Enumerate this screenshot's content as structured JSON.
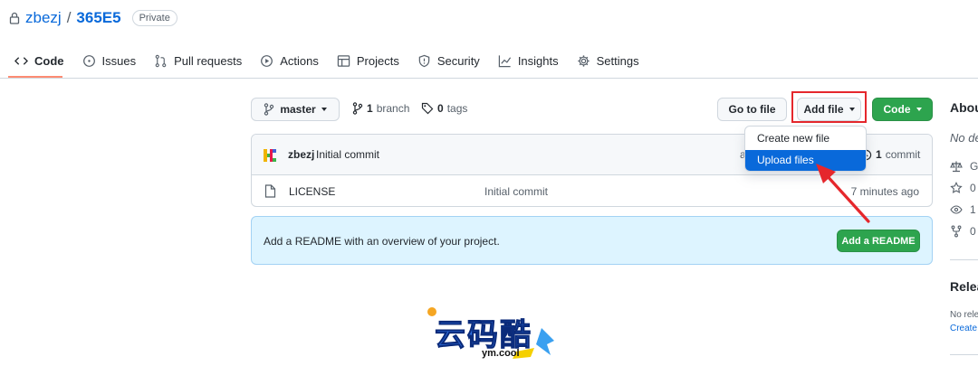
{
  "repo": {
    "owner": "zbezj",
    "separator": "/",
    "name": "365E5",
    "visibility": "Private"
  },
  "tabs": [
    {
      "label": "Code",
      "icon": "code-icon",
      "selected": true
    },
    {
      "label": "Issues",
      "icon": "issue-icon"
    },
    {
      "label": "Pull requests",
      "icon": "pull-request-icon"
    },
    {
      "label": "Actions",
      "icon": "play-icon"
    },
    {
      "label": "Projects",
      "icon": "table-icon"
    },
    {
      "label": "Security",
      "icon": "shield-icon"
    },
    {
      "label": "Insights",
      "icon": "graph-icon"
    },
    {
      "label": "Settings",
      "icon": "gear-icon"
    }
  ],
  "toolbar": {
    "branch": "master",
    "branch_count": "1",
    "branch_label": "branch",
    "tag_count": "0",
    "tag_label": "tags",
    "go_to_file": "Go to file",
    "add_file": "Add file",
    "code": "Code"
  },
  "dropdown": {
    "items": [
      {
        "label": "Create new file"
      },
      {
        "label": "Upload files",
        "active": true
      }
    ]
  },
  "latest_commit": {
    "author": "zbezj",
    "message": "Initial commit",
    "hash_fragment": "a",
    "commit_count": "1",
    "commit_label": "commit"
  },
  "files": [
    {
      "name": "LICENSE",
      "commit": "Initial commit",
      "age": "7 minutes ago"
    }
  ],
  "readme": {
    "text": "Add a README with an overview of your project.",
    "button": "Add a README"
  },
  "sidebar": {
    "about_title": "Abou",
    "description": "No de",
    "rows": [
      {
        "icon": "law-icon",
        "value": "G"
      },
      {
        "icon": "star-icon",
        "value": "0"
      },
      {
        "icon": "eye-icon",
        "value": "1"
      },
      {
        "icon": "fork-icon",
        "value": "0"
      }
    ],
    "releases_title": "Relea",
    "releases_note": "No rele",
    "releases_link": "Create"
  },
  "watermark": {
    "text": "云码酷",
    "sub": "ym.cool"
  },
  "colors": {
    "accent": "#0969da",
    "green": "#2da44e",
    "highlight": "#e5272c",
    "tab_underline": "#fd8c73"
  }
}
